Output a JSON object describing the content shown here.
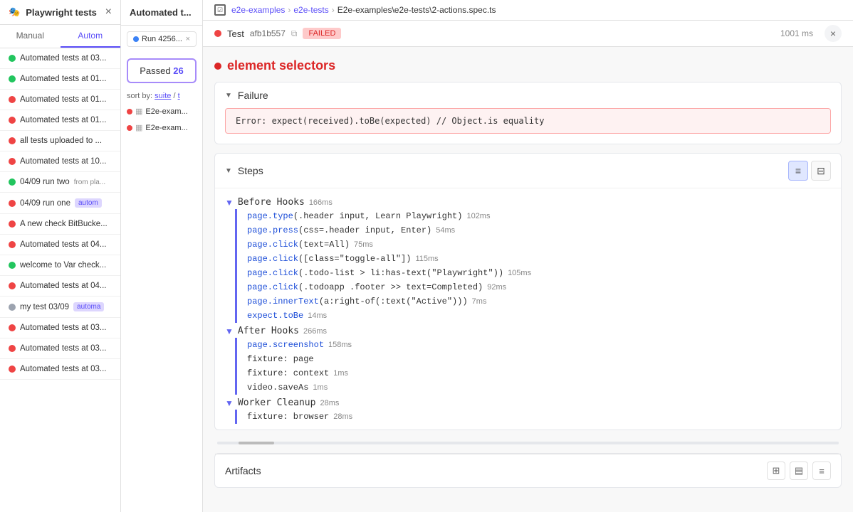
{
  "sidebar": {
    "title": "Playwright tests",
    "close_label": "×",
    "tabs": [
      {
        "id": "manual",
        "label": "Manual"
      },
      {
        "id": "auto",
        "label": "Autom"
      }
    ],
    "active_tab": "auto",
    "items": [
      {
        "id": 1,
        "status": "pass",
        "text": "Automated tests at 03..."
      },
      {
        "id": 2,
        "status": "pass",
        "text": "Automated tests at 01..."
      },
      {
        "id": 3,
        "status": "fail",
        "text": "Automated tests at 01..."
      },
      {
        "id": 4,
        "status": "fail",
        "text": "Automated tests at 01..."
      },
      {
        "id": 5,
        "status": "fail",
        "text": "all tests uploaded to ..."
      },
      {
        "id": 6,
        "status": "fail",
        "text": "Automated tests at 10..."
      },
      {
        "id": 7,
        "status": "pass",
        "text": "04/09 run two",
        "tag": "from pla..."
      },
      {
        "id": 8,
        "status": "fail",
        "text": "04/09 run one",
        "badge": "autom"
      },
      {
        "id": 9,
        "status": "fail",
        "text": "A new check BitBucke..."
      },
      {
        "id": 10,
        "status": "fail",
        "text": "Automated tests at 04..."
      },
      {
        "id": 11,
        "status": "pass",
        "text": "welcome to Var check..."
      },
      {
        "id": 12,
        "status": "fail",
        "text": "Automated tests at 04..."
      },
      {
        "id": 13,
        "status": "mute",
        "text": "my test 03/09",
        "badge": "automa"
      },
      {
        "id": 14,
        "status": "fail",
        "text": "Automated tests at 03..."
      },
      {
        "id": 15,
        "status": "fail",
        "text": "Automated tests at 03..."
      },
      {
        "id": 16,
        "status": "fail",
        "text": "Automated tests at 03..."
      }
    ]
  },
  "middle_panel": {
    "header_title": "Automated t...",
    "run_badge": "Run 4256...",
    "run_close": "×",
    "passed": {
      "label": "Passed",
      "count": "26"
    },
    "sort_label": "sort by:",
    "sort_suite": "suite",
    "sort_divider": "/",
    "sort_t": "t",
    "files": [
      {
        "id": 1,
        "text": "E2e-exam..."
      },
      {
        "id": 2,
        "text": "E2e-exam..."
      }
    ]
  },
  "breadcrumb": {
    "items": [
      {
        "id": "e2e-examples",
        "label": "e2e-examples"
      },
      {
        "id": "e2e-tests",
        "label": "e2e-tests"
      },
      {
        "id": "file",
        "label": "E2e-examples\\e2e-tests\\2-actions.spec.ts"
      }
    ],
    "checkbox_icon": "☑"
  },
  "test_header": {
    "name": "Test",
    "hash": "afb1b557",
    "failed_label": "FAILED",
    "duration": "1001 ms"
  },
  "main": {
    "suite_name": "element selectors",
    "sections": {
      "failure": {
        "label": "Failure",
        "error": "Error: expect(received).toBe(expected) // Object.is equality"
      },
      "steps": {
        "label": "Steps",
        "groups": [
          {
            "id": "before-hooks",
            "name": "Before Hooks",
            "duration": "166ms",
            "steps": [
              {
                "code": "page.type(.header input, Learn Playwright)",
                "duration": "102ms"
              },
              {
                "code": "page.press(css=.header input, Enter)",
                "duration": "54ms"
              },
              {
                "code": "page.click(text=All)",
                "duration": "75ms"
              },
              {
                "code": "page.click([class=\"toggle-all\"])",
                "duration": "115ms"
              },
              {
                "code": "page.click(.todo-list > li:has-text(\"Playwright\"))",
                "duration": "105ms"
              },
              {
                "code": "page.click(.todoapp .footer >> text=Completed)",
                "duration": "92ms"
              },
              {
                "code": "page.innerText(a:right-of(:text(\"Active\")))",
                "duration": "7ms"
              },
              {
                "code": "expect.toBe",
                "duration": "14ms"
              }
            ]
          },
          {
            "id": "after-hooks",
            "name": "After Hooks",
            "duration": "266ms",
            "steps": [
              {
                "code": "page.screenshot",
                "duration": "158ms"
              },
              {
                "code": "fixture: page",
                "duration": ""
              },
              {
                "code": "fixture: context",
                "duration": "1ms"
              },
              {
                "code": "video.saveAs",
                "duration": "1ms"
              }
            ]
          },
          {
            "id": "worker-cleanup",
            "name": "Worker Cleanup",
            "duration": "28ms",
            "steps": [
              {
                "code": "fixture: browser",
                "duration": "28ms"
              }
            ]
          }
        ]
      },
      "artifacts": {
        "label": "Artifacts"
      }
    }
  }
}
